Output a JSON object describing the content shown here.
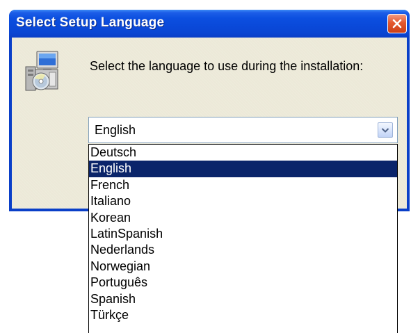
{
  "window": {
    "title": "Select Setup Language"
  },
  "dialog": {
    "prompt": "Select the language to use during the installation:",
    "icon": "setup-installer-icon"
  },
  "language_select": {
    "selected_value": "English",
    "options": [
      "Deutsch",
      "English",
      "French",
      "Italiano",
      "Korean",
      "LatinSpanish",
      "Nederlands",
      "Norwegian",
      "Português",
      "Spanish",
      "Türkçe"
    ],
    "highlighted_index": 1
  },
  "colors": {
    "titlebar": "#0a49d9",
    "dialog_face": "#ece9d8",
    "selection": "#0a246a",
    "close_button": "#e4582e"
  }
}
